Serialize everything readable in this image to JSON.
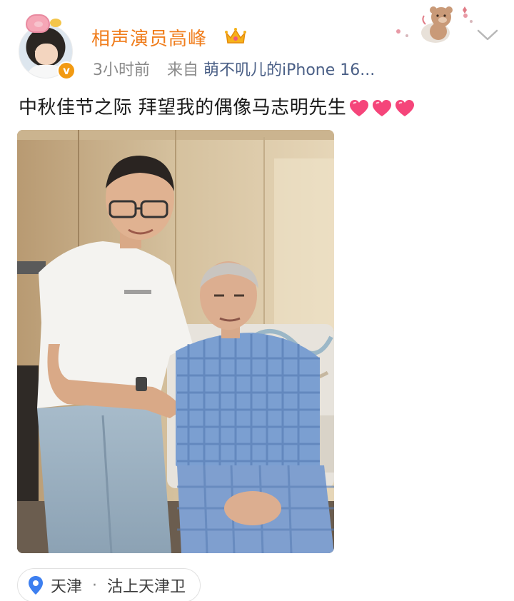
{
  "post": {
    "author": {
      "name": "相声演员高峰",
      "avatar_icon": "child-avatar",
      "verified_badge": "v"
    },
    "meta": {
      "time": "3小时前",
      "from_label": "来自",
      "source": "萌不叽儿的iPhone 16..."
    },
    "text": "中秋佳节之际 拜望我的偶像马志明先生",
    "text_emoji": [
      "heart-icon",
      "heart-icon",
      "heart-icon"
    ],
    "location": {
      "city": "天津",
      "separator": "·",
      "place": "沽上天津卫"
    }
  },
  "colors": {
    "username": "#f07d1c",
    "source_link": "#4a5f86",
    "badge": "#f29a12",
    "location_pin": "#3d7ff0",
    "heart": "#f5457a"
  }
}
